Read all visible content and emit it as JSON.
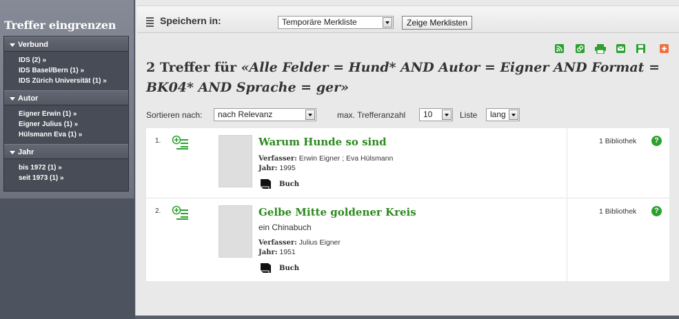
{
  "sidebar": {
    "title": "Treffer eingrenzen",
    "facets": [
      {
        "heading": "Verbund",
        "items": [
          "IDS  (2) »",
          "IDS Basel/Bern  (1) »",
          "IDS Zürich Universität  (1) »"
        ]
      },
      {
        "heading": "Autor",
        "items": [
          "Eigner Erwin  (1) »",
          "Eigner Julius  (1) »",
          "Hülsmann Eva  (1) »"
        ]
      },
      {
        "heading": "Jahr",
        "items": [
          "bis 1972  (1) »",
          "seit 1973  (1) »"
        ]
      }
    ]
  },
  "save_bar": {
    "label": "Speichern in:",
    "list_select": "Temporäre Merkliste",
    "show_button": "Zeige Merklisten"
  },
  "toolbar_icons": [
    "rss-icon",
    "link-icon",
    "print-icon",
    "email-icon",
    "save-icon",
    "share-icon"
  ],
  "colors": {
    "accent_green": "#2c8a1e",
    "icon_green": "#2ba12f",
    "share_orange": "#f0703c",
    "sidebar_bg": "#7a7e8a"
  },
  "results": {
    "heading_prefix": "2 Treffer für ",
    "heading_query": "«Alle Felder = Hund* AND Autor = Eigner AND Format = BK04* AND Sprache = ger»",
    "sort_label": "Sortieren nach:",
    "sort_value": "nach Relevanz",
    "max_label": "max. Trefferanzahl",
    "max_value": "10",
    "list_label": "Liste",
    "list_value": "lang",
    "items": [
      {
        "num": "1.",
        "title": "Warum Hunde so sind",
        "subtitle": "",
        "author_label": "Verfasser:",
        "author": "Erwin Eigner ; Eva Hülsmann",
        "year_label": "Jahr:",
        "year": "1995",
        "type": "Buch",
        "libraries": "1  Bibliothek",
        "help": "?"
      },
      {
        "num": "2.",
        "title": "Gelbe Mitte goldener Kreis",
        "subtitle": "ein Chinabuch",
        "author_label": "Verfasser:",
        "author": "Julius Eigner",
        "year_label": "Jahr:",
        "year": "1951",
        "type": "Buch",
        "libraries": "1  Bibliothek",
        "help": "?"
      }
    ]
  }
}
